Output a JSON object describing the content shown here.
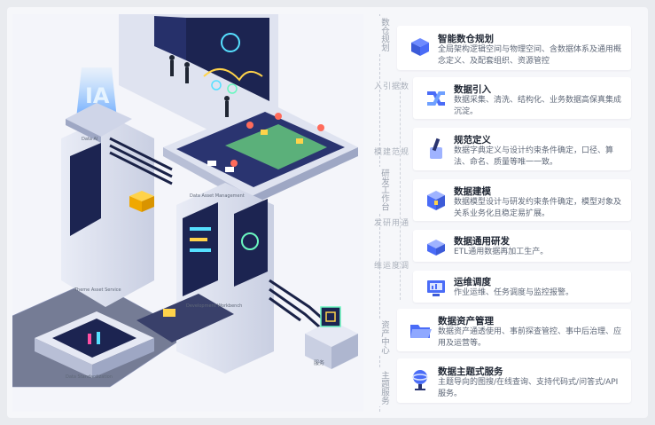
{
  "rail": {
    "top_label": "数仓规划",
    "mid_label": "研发工作台",
    "low_label": "资产中心",
    "bottom_label": "主题服务"
  },
  "sub_rail": {
    "s1": "数据引入",
    "s2": "规范建模",
    "s3": "通用研发",
    "s4": "调度运维"
  },
  "cards": [
    {
      "title": "智能数仓规划",
      "desc": "全局架构逻辑空间与物理空间、含数据体系及通用概念定义、及配套组织、资源管控",
      "icon": "cube-stack-icon"
    },
    {
      "title": "数据引入",
      "desc": "数据采集、清洗、结构化、业务数据高保真集成沉淀。",
      "icon": "shuffle-icon"
    },
    {
      "title": "规范定义",
      "desc": "数据字典定义与设计约束条件确定，口径、算法、命名、质量等唯一一致。",
      "icon": "pen-cup-icon"
    },
    {
      "title": "数据建模",
      "desc": "数据模型设计与研发约束条件确定，模型对象及关系业务化且稳定易扩展。",
      "icon": "cube-icon"
    },
    {
      "title": "数据通用研发",
      "desc": "ETL通用数据再加工生产。",
      "icon": "server-icon"
    },
    {
      "title": "运维调度",
      "desc": "作业运维、任务调度与监控报警。",
      "icon": "monitor-icon"
    },
    {
      "title": "数据资产管理",
      "desc": "数据资产通透使用、事前探查管控、事中后治理、应用及运营等。",
      "icon": "folder-icon"
    },
    {
      "title": "数据主题式服务",
      "desc": "主题导向的图搜/在线查询、支持代码式/问答式/API服务。",
      "icon": "globe-icon"
    }
  ],
  "illustration": {
    "ia_text": "IA",
    "labels": [
      "Data AI",
      "Data Asset Management",
      "Theme Asset Service",
      "Data Standardization",
      "Development Workbench",
      "服务"
    ]
  },
  "colors": {
    "accent": "#4a6cf7",
    "ink": "#1f2633"
  }
}
